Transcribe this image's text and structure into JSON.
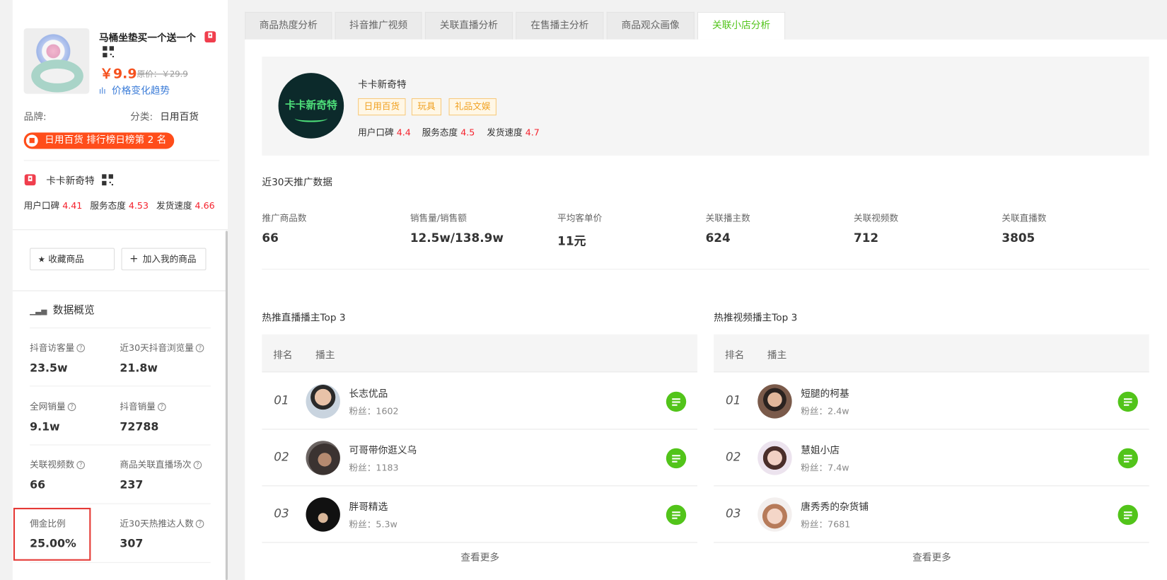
{
  "product": {
    "name": "马桶坐垫买一个送一个",
    "price": "￥9.9",
    "original_price": "原价：￥29.9",
    "trend_link": "价格变化趋势",
    "brand_label": "品牌:",
    "category_label": "分类:",
    "category": "日用百货",
    "rank_badge": "日用百货 排行榜日榜第 2 名"
  },
  "shop_side": {
    "name": "卡卡新奇特",
    "scores": [
      {
        "label": "用户口碑",
        "value": "4.41"
      },
      {
        "label": "服务态度",
        "value": "4.53"
      },
      {
        "label": "发货速度",
        "value": "4.66"
      }
    ]
  },
  "actions": {
    "favorite": "收藏商品",
    "add": "加入我的商品"
  },
  "overview": {
    "title": "数据概览",
    "metrics": [
      {
        "label": "抖音访客量",
        "value": "23.5w"
      },
      {
        "label": "近30天抖音浏览量",
        "value": "21.8w"
      },
      {
        "label": "全网销量",
        "value": "9.1w"
      },
      {
        "label": "抖音销量",
        "value": "72788"
      },
      {
        "label": "关联视频数",
        "value": "66"
      },
      {
        "label": "商品关联直播场次",
        "value": "237"
      },
      {
        "label": "佣金比例",
        "value": "25.00%"
      },
      {
        "label": "近30天热推达人数",
        "value": "307"
      }
    ]
  },
  "tabs": [
    "商品热度分析",
    "抖音推广视频",
    "关联直播分析",
    "在售播主分析",
    "商品观众画像",
    "关联小店分析"
  ],
  "shop": {
    "name": "卡卡新奇特",
    "logo_text": "卡卡新奇特",
    "tags": [
      "日用百货",
      "玩具",
      "礼品文娱"
    ],
    "scores": [
      {
        "label": "用户口碑",
        "value": "4.4"
      },
      {
        "label": "服务态度",
        "value": "4.5"
      },
      {
        "label": "发货速度",
        "value": "4.7"
      }
    ]
  },
  "promo": {
    "title": "近30天推广数据",
    "kpis": [
      {
        "label": "推广商品数",
        "value": "66"
      },
      {
        "label": "销售量/销售额",
        "value": "12.5w/138.9w"
      },
      {
        "label": "平均客单价",
        "value": "11元"
      },
      {
        "label": "关联播主数",
        "value": "624"
      },
      {
        "label": "关联视频数",
        "value": "712"
      },
      {
        "label": "关联直播数",
        "value": "3805"
      }
    ]
  },
  "live_top": {
    "title": "热推直播播主Top 3",
    "col_rank": "排名",
    "col_host": "播主",
    "rows": [
      {
        "rank": "01",
        "name": "长志优品",
        "fans": "粉丝：1602"
      },
      {
        "rank": "02",
        "name": "可哥带你逛义乌",
        "fans": "粉丝：1183"
      },
      {
        "rank": "03",
        "name": "胖哥精选",
        "fans": "粉丝：5.3w"
      }
    ],
    "more": "查看更多"
  },
  "video_top": {
    "title": "热推视频播主Top 3",
    "col_rank": "排名",
    "col_host": "播主",
    "rows": [
      {
        "rank": "01",
        "name": "短腿的柯基",
        "fans": "粉丝：2.4w"
      },
      {
        "rank": "02",
        "name": "慧姐小店",
        "fans": "粉丝：7.4w"
      },
      {
        "rank": "03",
        "name": "唐秀秀的杂货铺",
        "fans": "粉丝：7681"
      }
    ],
    "more": "查看更多"
  },
  "colors": {
    "accent": "#52c41a",
    "price": "#f5511e",
    "score": "#f5222d",
    "link": "#3b7cd8"
  }
}
